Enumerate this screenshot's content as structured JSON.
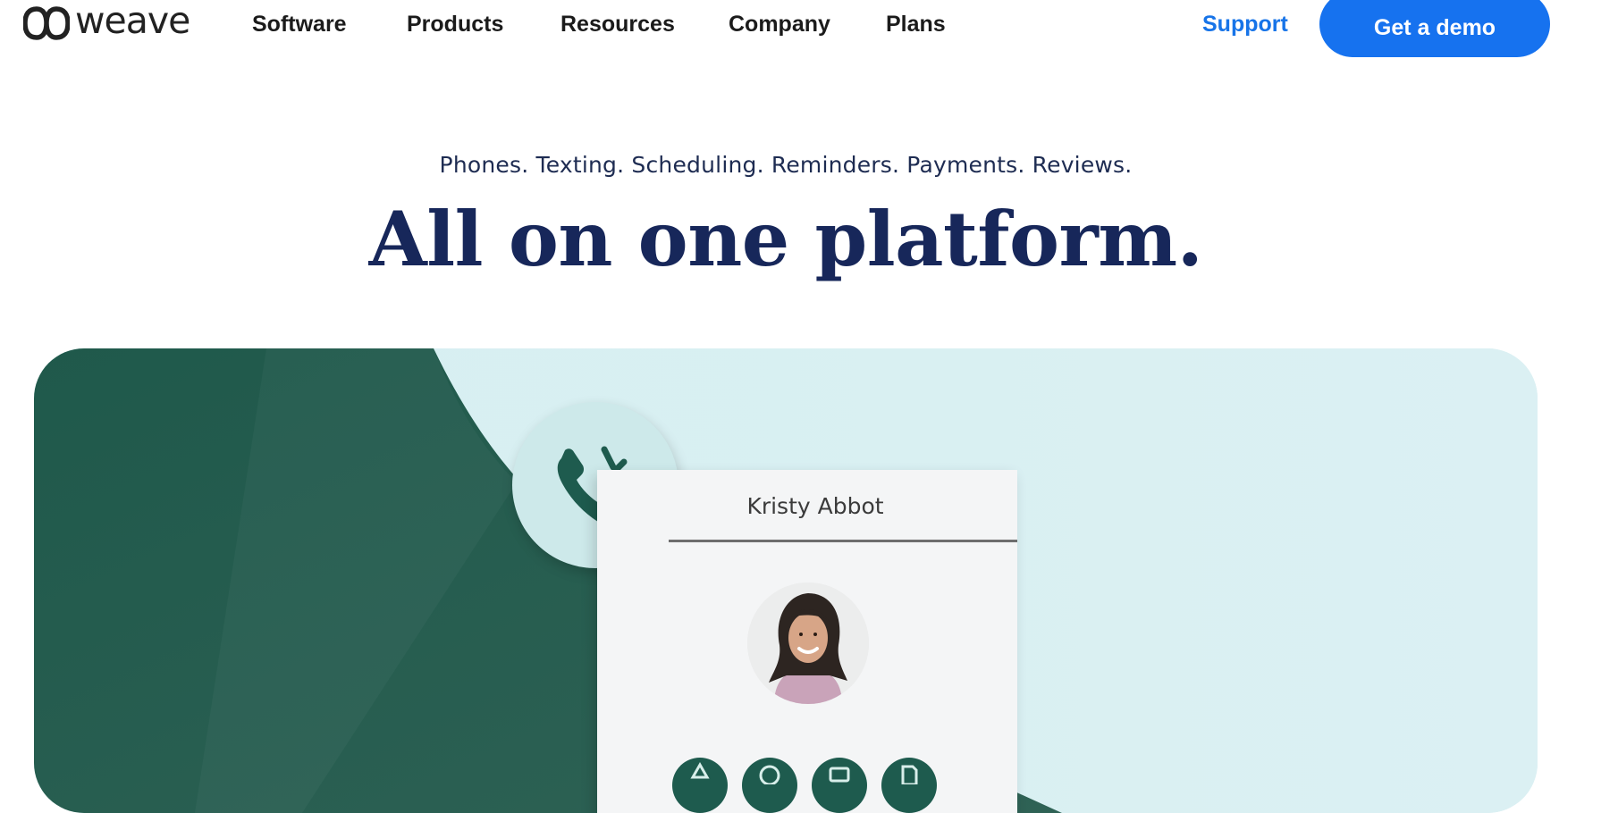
{
  "brand": {
    "name": "weave",
    "logo_icon": "weave-knot-logo"
  },
  "nav": {
    "items": [
      {
        "label": "Software"
      },
      {
        "label": "Products"
      },
      {
        "label": "Resources"
      },
      {
        "label": "Company"
      },
      {
        "label": "Plans"
      }
    ],
    "support_label": "Support",
    "demo_label": "Get a demo"
  },
  "hero": {
    "tagline": "Phones. Texting. Scheduling. Reminders. Payments. Reviews.",
    "headline": "All on one platform."
  },
  "illustration": {
    "contact_name": "Kristy Abbot",
    "call_icon": "phone-ringing-icon",
    "actions": [
      "action-icon",
      "chat-icon",
      "card-icon",
      "document-icon"
    ]
  },
  "colors": {
    "accent": "#1672ef",
    "support_link": "#1774e8",
    "headline": "#17275a",
    "hero_green": "#245b4d",
    "hero_mint": "#d2eef0"
  }
}
